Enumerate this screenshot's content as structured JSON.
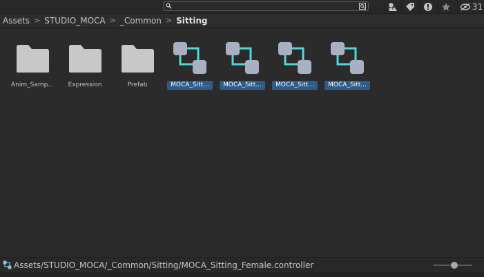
{
  "toolbar": {
    "search_value": "",
    "buttons": [
      {
        "name": "search-by-type-icon"
      },
      {
        "name": "search-by-label-icon"
      },
      {
        "name": "warning-filter-icon"
      },
      {
        "name": "favorites-star-icon"
      }
    ],
    "hidden_count": "31"
  },
  "breadcrumb": [
    "Assets",
    "STUDIO_MOCA",
    "_Common",
    "Sitting"
  ],
  "items": [
    {
      "label": "Anim_Samp...",
      "type": "folder",
      "selected": false
    },
    {
      "label": "Expression",
      "type": "folder",
      "selected": false
    },
    {
      "label": "Prefab",
      "type": "folder",
      "selected": false
    },
    {
      "label": "MOCA_Sitt...",
      "type": "animator-controller",
      "selected": true
    },
    {
      "label": "MOCA_Sitt...",
      "type": "animator-controller",
      "selected": true
    },
    {
      "label": "MOCA_Sitt...",
      "type": "animator-controller",
      "selected": true
    },
    {
      "label": "MOCA_Sitt...",
      "type": "animator-controller",
      "selected": true
    }
  ],
  "status": {
    "path": "Assets/STUDIO_MOCA/_Common/Sitting/MOCA_Sitting_Female.controller",
    "zoom": 0.55
  },
  "colors": {
    "selection": "#2d5c8a",
    "folder": "#c8c8c8",
    "controller_node": "#a9b0c2",
    "controller_link": "#4fd8d8"
  }
}
